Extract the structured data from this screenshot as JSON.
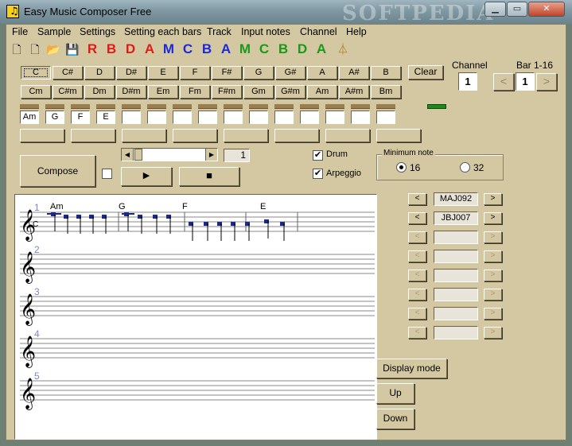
{
  "window": {
    "title": "Easy Music Composer Free",
    "watermark": "SOFTPEDIA"
  },
  "menu": [
    "File",
    "Sample",
    "Settings",
    "Setting each bars",
    "Track",
    "Input notes",
    "Channel",
    "Help"
  ],
  "toolbar_letters": [
    {
      "t": "R",
      "c": "#e01b1b"
    },
    {
      "t": "B",
      "c": "#e01b1b"
    },
    {
      "t": "D",
      "c": "#e01b1b"
    },
    {
      "t": "A",
      "c": "#e01b1b"
    },
    {
      "t": "M",
      "c": "#1b2ad8"
    },
    {
      "t": "C",
      "c": "#1b2ad8"
    },
    {
      "t": "B",
      "c": "#1b2ad8"
    },
    {
      "t": "A",
      "c": "#1b2ad8"
    },
    {
      "t": "M",
      "c": "#1a9a1a"
    },
    {
      "t": "C",
      "c": "#1a9a1a"
    },
    {
      "t": "B",
      "c": "#1a9a1a"
    },
    {
      "t": "D",
      "c": "#1a9a1a"
    },
    {
      "t": "A",
      "c": "#1a9a1a"
    }
  ],
  "chords_major": [
    "C",
    "C#",
    "D",
    "D#",
    "E",
    "F",
    "F#",
    "G",
    "G#",
    "A",
    "A#",
    "B"
  ],
  "chords_minor": [
    "Cm",
    "C#m",
    "Dm",
    "D#m",
    "Em",
    "Fm",
    "F#m",
    "Gm",
    "G#m",
    "Am",
    "A#m",
    "Bm"
  ],
  "clear_label": "Clear",
  "channel": {
    "label": "Channel",
    "value": "1"
  },
  "bar": {
    "label": "Bar 1-16",
    "value": "1",
    "prev": "<",
    "next": ">"
  },
  "chord_slots": [
    "Am",
    "G",
    "F",
    "E",
    "",
    "",
    "",
    "",
    "",
    "",
    "",
    "",
    "",
    "",
    ""
  ],
  "compose_label": "Compose",
  "position_value": "1",
  "drum": {
    "label": "Drum",
    "checked": "✔"
  },
  "arpeggio": {
    "label": "Arpeggio",
    "checked": "✔"
  },
  "minimum_note": {
    "label": "Minimum note",
    "options": [
      "16",
      "32"
    ]
  },
  "tracks": [
    {
      "prev": "<",
      "name": "MAJ092",
      "next": ">"
    },
    {
      "prev": "<",
      "name": "JBJ007",
      "next": ">"
    },
    {
      "prev": "<",
      "name": "",
      "next": ">"
    },
    {
      "prev": "<",
      "name": "",
      "next": ">"
    },
    {
      "prev": "<",
      "name": "",
      "next": ">"
    },
    {
      "prev": "<",
      "name": "",
      "next": ">"
    },
    {
      "prev": "<",
      "name": "",
      "next": ">"
    },
    {
      "prev": "<",
      "name": "",
      "next": ">"
    }
  ],
  "display_mode_label": "Display mode",
  "up_label": "Up",
  "down_label": "Down",
  "staff": {
    "numbers": [
      "1",
      "2",
      "3",
      "4",
      "5"
    ],
    "key_marker": "C",
    "chord_labels": [
      "Am",
      "G",
      "F",
      "E"
    ]
  }
}
